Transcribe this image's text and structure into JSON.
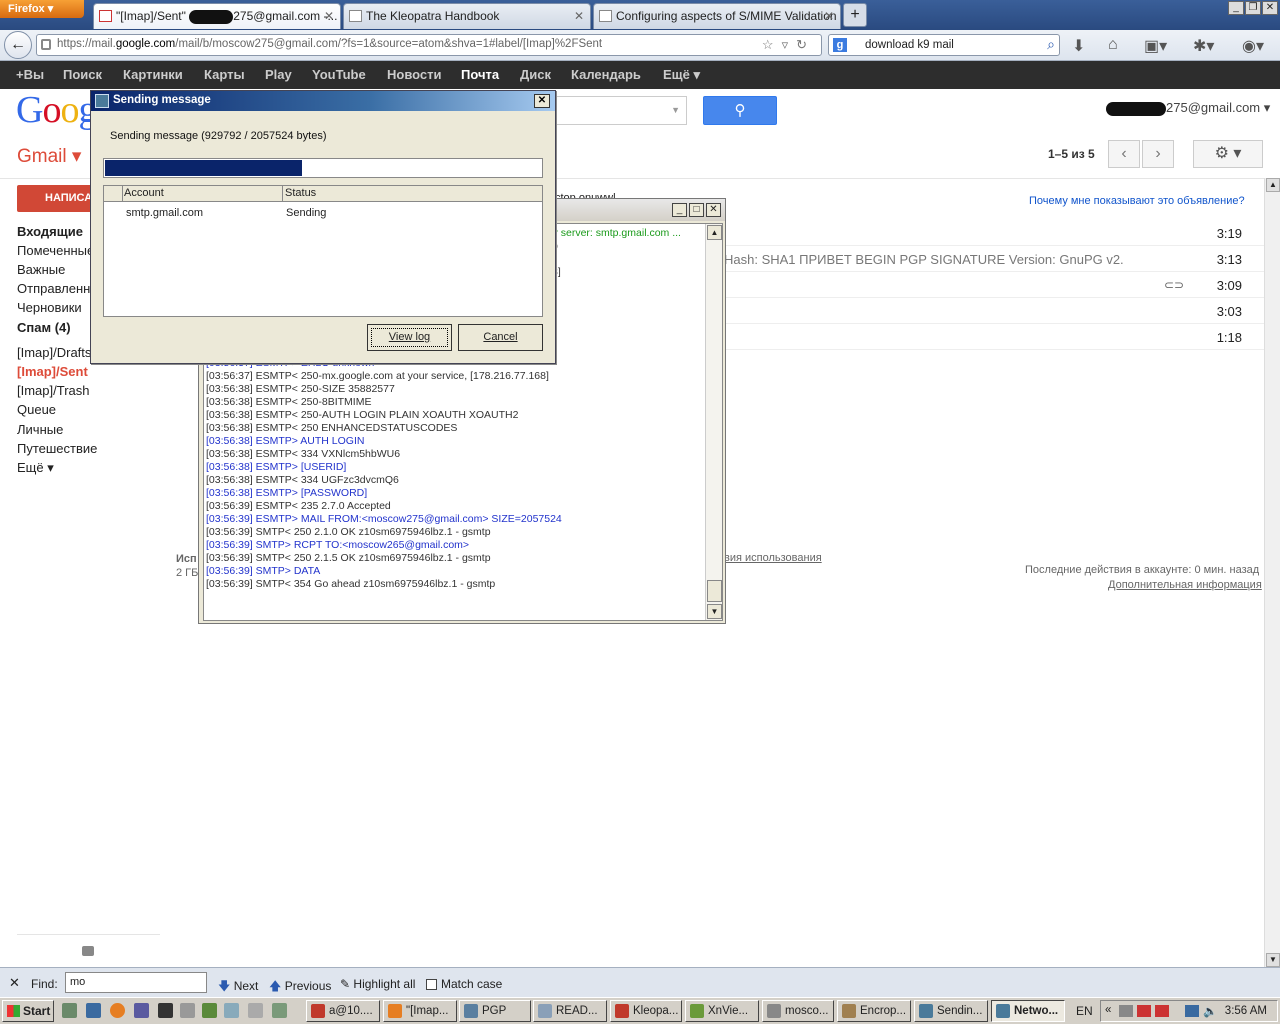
{
  "browser": {
    "app_button": "Firefox",
    "tabs": [
      {
        "label_prefix": "\"[Imap]/Sent\"",
        "label_suffix": "275@gmail.com -...",
        "active": true
      },
      {
        "label": "The Kleopatra Handbook",
        "active": false
      },
      {
        "label": "Configuring aspects of S/MIME Validation",
        "active": false
      }
    ],
    "url_prefix": "https://mail.",
    "url_domain": "google.com",
    "url_rest": "/mail/b/moscow275@gmail.com/?fs=1&source=atom&shva=1#label/[Imap]%2FSent",
    "search_value": "download k9 mail"
  },
  "google_bar": [
    "+Вы",
    "Поиск",
    "Картинки",
    "Карты",
    "Play",
    "YouTube",
    "Новости",
    "Почта",
    "Диск",
    "Календарь",
    "Ещё ▾"
  ],
  "gmail": {
    "logo": "Google",
    "label": "Gmail ▾",
    "account_suffix": "275@gmail.com ▾",
    "pager": "1–5 из 5",
    "compose": "НАПИСАТЬ",
    "sidebar": [
      "Входящие",
      "Помеченные",
      "Важные",
      "Отправленные",
      "Черновики",
      "Спам (4)",
      "[Imap]/Drafts",
      "[Imap]/Sent",
      "[Imap]/Trash",
      "Queue",
      "Личные",
      "Путешествие",
      "Ещё ▾"
    ],
    "ad_link": "Почему мне показывают это объявление?",
    "ad_fragment": "ctop onuwwl",
    "rows": [
      {
        "snippet": "",
        "time": "3:19"
      },
      {
        "snippet": "Hash: SHA1 ПРИВЕТ BEGIN PGP SIGNATURE Version: GnuPG v2.",
        "time": "3:13"
      },
      {
        "snippet": "",
        "time": "3:09",
        "attachment": true
      },
      {
        "snippet": "",
        "time": "3:03"
      },
      {
        "snippet": "",
        "time": "1:18"
      }
    ],
    "footer_left_1": "Исп",
    "footer_left_2": "2 ГБ",
    "footer_link": "вия использования",
    "last_activity": "Последние действия в аккаунте: 0 мин. назад",
    "more_info": "Дополнительная информация"
  },
  "log_window": {
    "lines": [
      {
        "t": "? server: smtp.gmail.com ...",
        "k": "ok",
        "indent": true
      },
      {
        "t": "p",
        "k": "in",
        "indent": true
      },
      {
        "t": "",
        "k": "in",
        "indent": true
      },
      {
        "t": "3]",
        "k": "in",
        "indent": true
      },
      {
        "t": "",
        "k": "in"
      },
      {
        "t": "",
        "k": "in"
      },
      {
        "t": "",
        "k": "in"
      },
      {
        "t": "",
        "k": "in"
      },
      {
        "t": "",
        "k": "in"
      },
      {
        "t": "[03:56:37] ESMTP< 220 2.0.0 Ready to start TLS",
        "k": "in"
      },
      {
        "t": "[03:56:37] ESMTP> EHLO unknown",
        "k": "out"
      },
      {
        "t": "[03:56:37] ESMTP< 250-mx.google.com at your service, [178.216.77.168]",
        "k": "in"
      },
      {
        "t": "[03:56:38] ESMTP< 250-SIZE 35882577",
        "k": "in"
      },
      {
        "t": "[03:56:38] ESMTP< 250-8BITMIME",
        "k": "in"
      },
      {
        "t": "[03:56:38] ESMTP< 250-AUTH LOGIN PLAIN XOAUTH XOAUTH2",
        "k": "in"
      },
      {
        "t": "[03:56:38] ESMTP< 250 ENHANCEDSTATUSCODES",
        "k": "in"
      },
      {
        "t": "[03:56:38] ESMTP> AUTH LOGIN",
        "k": "out"
      },
      {
        "t": "[03:56:38] ESMTP< 334 VXNlcm5hbWU6",
        "k": "in"
      },
      {
        "t": "[03:56:38] ESMTP> [USERID]",
        "k": "out"
      },
      {
        "t": "[03:56:38] ESMTP< 334 UGFzc3dvcmQ6",
        "k": "in"
      },
      {
        "t": "[03:56:38] ESMTP> [PASSWORD]",
        "k": "out"
      },
      {
        "t": "[03:56:39] ESMTP< 235 2.7.0 Accepted",
        "k": "in"
      },
      {
        "t": "[03:56:39] ESMTP> MAIL FROM:<moscow275@gmail.com> SIZE=2057524",
        "k": "out"
      },
      {
        "t": "[03:56:39] SMTP< 250 2.1.0 OK z10sm6975946lbz.1 - gsmtp",
        "k": "in"
      },
      {
        "t": "[03:56:39] SMTP> RCPT TO:<moscow265@gmail.com>",
        "k": "out"
      },
      {
        "t": "[03:56:39] SMTP< 250 2.1.5 OK z10sm6975946lbz.1 - gsmtp",
        "k": "in"
      },
      {
        "t": "[03:56:39] SMTP> DATA",
        "k": "out"
      },
      {
        "t": "[03:56:39] SMTP< 354  Go ahead z10sm6975946lbz.1 - gsmtp",
        "k": "in"
      }
    ]
  },
  "send_dialog": {
    "title": "Sending message",
    "status": "Sending message (929792 / 2057524 bytes)",
    "progress_fraction": 0.452,
    "col_account": "Account",
    "col_status": "Status",
    "account": "smtp.gmail.com",
    "account_status": "Sending",
    "view_log": "View log",
    "cancel": "Cancel"
  },
  "findbar": {
    "close": "✕",
    "label": "Find:",
    "value": "mo",
    "next": "Next",
    "previous": "Previous",
    "highlight": "Highlight all",
    "match_case": "Match case"
  },
  "taskbar": {
    "start": "Start",
    "tasks": [
      {
        "label": "a@10....",
        "color": "#c0392b"
      },
      {
        "label": "\"[Imap...",
        "color": "#e67e22"
      },
      {
        "label": "PGP",
        "color": "#5a7fa0"
      },
      {
        "label": "READ...",
        "color": "#8aa0b8"
      },
      {
        "label": "Kleopa...",
        "color": "#c0392b"
      },
      {
        "label": "XnVie...",
        "color": "#6a9a3a"
      },
      {
        "label": "mosco...",
        "color": "#888888"
      },
      {
        "label": "Encrop...",
        "color": "#a08050"
      },
      {
        "label": "Sendin...",
        "color": "#4a7a9a"
      },
      {
        "label": "Netwo...",
        "color": "#4a7a9a",
        "active": true
      }
    ],
    "lang": "EN",
    "clock": "3:56 AM"
  }
}
